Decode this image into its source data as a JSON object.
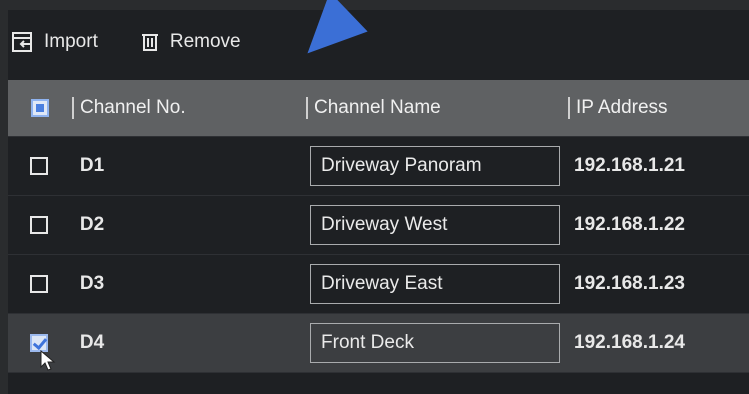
{
  "toolbar": {
    "import_label": "Import",
    "remove_label": "Remove"
  },
  "table": {
    "headers": [
      "Channel No.",
      "Channel Name",
      "IP Address"
    ],
    "rows": [
      {
        "channel": "D1",
        "name": "Driveway Panoram",
        "ip": "192.168.1.21",
        "checked": false
      },
      {
        "channel": "D2",
        "name": "Driveway West",
        "ip": "192.168.1.22",
        "checked": false
      },
      {
        "channel": "D3",
        "name": "Driveway East",
        "ip": "192.168.1.23",
        "checked": false
      },
      {
        "channel": "D4",
        "name": "Front Deck",
        "ip": "192.168.1.24",
        "checked": true
      }
    ]
  },
  "colors": {
    "accent": "#3b6fd6",
    "header_bg": "#5f6163",
    "body_bg": "#1e2023"
  },
  "icons": [
    "import-icon",
    "trash-icon",
    "mouse-cursor-icon"
  ]
}
